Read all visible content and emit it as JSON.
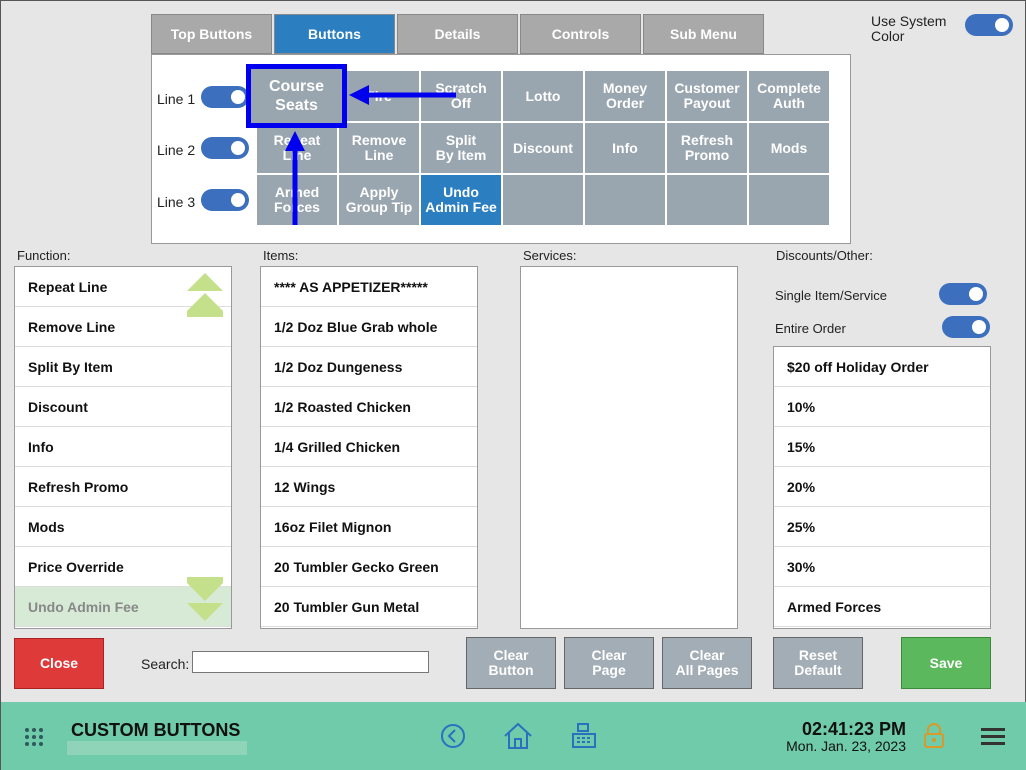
{
  "tabs": [
    "Top Buttons",
    "Buttons",
    "Details",
    "Controls",
    "Sub Menu"
  ],
  "system_color": {
    "label": "Use System\nColor"
  },
  "lines": [
    "Line 1",
    "Line 2",
    "Line 3"
  ],
  "grid": [
    "Course\nSeats",
    "Fire",
    "Scratch\nOff",
    "Lotto",
    "Money\nOrder",
    "Customer\nPayout",
    "Complete\nAuth",
    "Repeat\nLine",
    "Remove\nLine",
    "Split\nBy Item",
    "Discount",
    "Info",
    "Refresh\nPromo",
    "Mods",
    "Armed\nForces",
    "Apply\nGroup Tip",
    "Undo\nAdmin Fee",
    "",
    "",
    "",
    ""
  ],
  "labels": {
    "function": "Function:",
    "items": "Items:",
    "services": "Services:",
    "discounts": "Discounts/Other:"
  },
  "function_list": [
    "Repeat Line",
    "Remove Line",
    "Split By Item",
    "Discount",
    "Info",
    "Refresh Promo",
    "Mods",
    "Price Override",
    "Undo Admin Fee"
  ],
  "items_list": [
    "**** AS APPETIZER*****",
    "1/2 Doz Blue Grab whole",
    "1/2 Doz Dungeness",
    "1/2 Roasted Chicken",
    "1/4 Grilled Chicken",
    "12 Wings",
    "16oz Filet Mignon",
    "20 Tumbler Gecko Green",
    "20 Tumbler Gun Metal"
  ],
  "discount_toggles": [
    "Single Item/Service",
    "Entire Order"
  ],
  "discount_list": [
    "$20 off Holiday Order",
    "10%",
    "15%",
    "20%",
    "25%",
    "30%",
    "Armed Forces"
  ],
  "bottom": {
    "close": "Close",
    "search_label": "Search:",
    "clear_button": "Clear\nButton",
    "clear_page": "Clear\nPage",
    "clear_all": "Clear\nAll Pages",
    "reset_default": "Reset\nDefault",
    "save": "Save"
  },
  "footer": {
    "title": "CUSTOM BUTTONS",
    "time": "02:41:23 PM",
    "date": "Mon. Jan. 23, 2023"
  },
  "colors": {
    "accent": "#2b7fc1",
    "footer": "#6fcbaa",
    "close": "#de3a3a",
    "save": "#5cb85c",
    "annotation": "#0000ee"
  }
}
